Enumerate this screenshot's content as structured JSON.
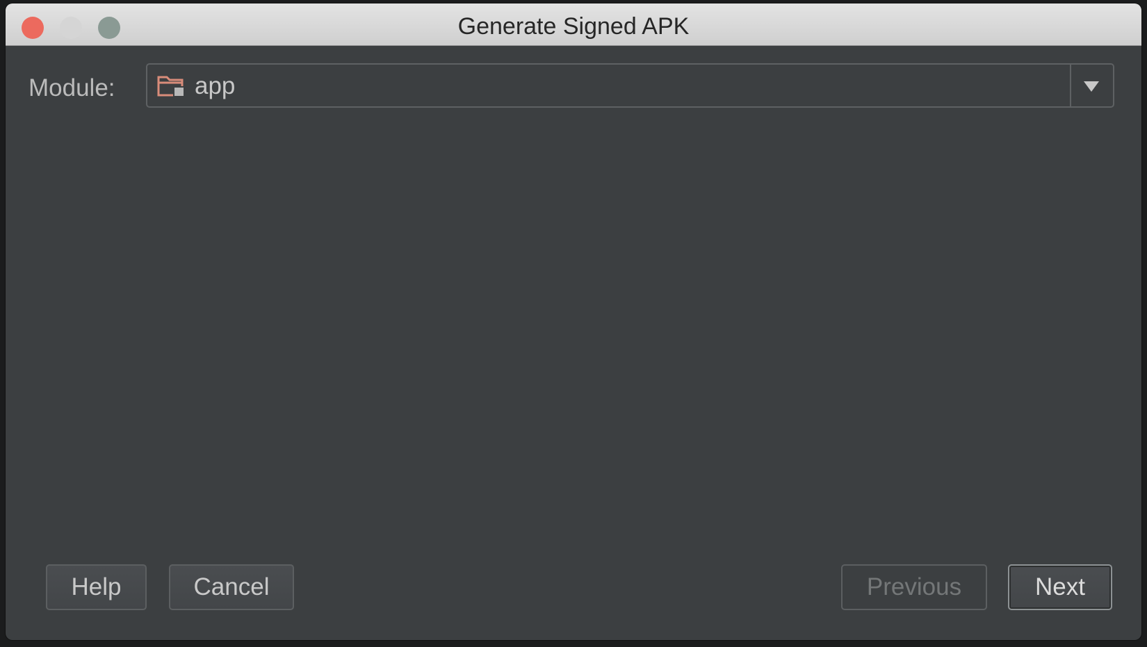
{
  "window": {
    "title": "Generate Signed APK"
  },
  "form": {
    "module_label": "Module:",
    "module_value": "app",
    "module_icon": "module-folder-icon"
  },
  "buttons": {
    "help": "Help",
    "cancel": "Cancel",
    "previous": "Previous",
    "next": "Next"
  },
  "colors": {
    "close": "#ec6a5e",
    "minimize": "#d5d5d5",
    "maximize": "#8a9a94",
    "dialog_bg": "#3c3f41",
    "folder_icon": "#d98c7a"
  }
}
